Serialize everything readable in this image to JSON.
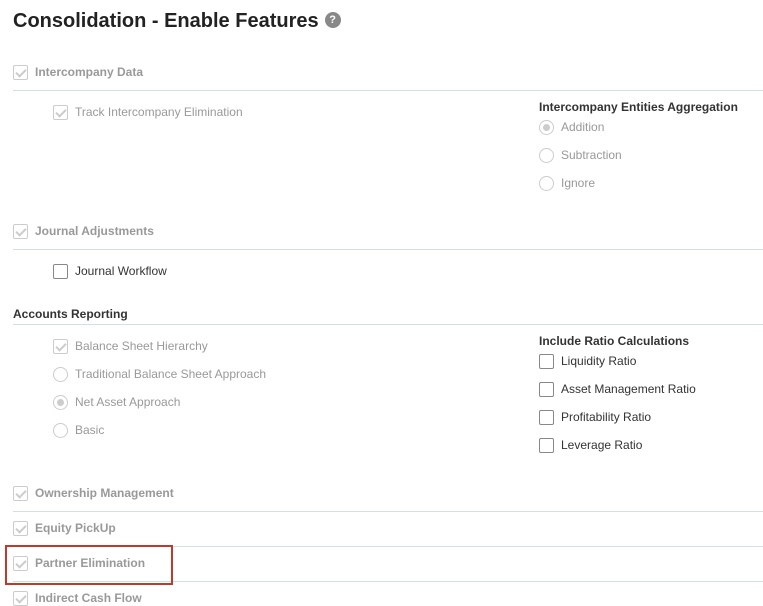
{
  "title": "Consolidation - Enable Features",
  "help_icon": "?",
  "intercompany": {
    "label": "Intercompany Data",
    "checked": true,
    "track": {
      "label": "Track Intercompany Elimination",
      "checked": true
    },
    "aggregation": {
      "heading": "Intercompany Entities Aggregation",
      "options": [
        "Addition",
        "Subtraction",
        "Ignore"
      ],
      "selected": "Addition"
    }
  },
  "journal": {
    "label": "Journal Adjustments",
    "checked": true,
    "workflow": {
      "label": "Journal Workflow",
      "checked": false
    }
  },
  "accounts": {
    "heading": "Accounts Reporting",
    "balance_sheet": {
      "label": "Balance Sheet Hierarchy",
      "checked": true
    },
    "approaches": [
      "Traditional Balance Sheet Approach",
      "Net Asset Approach",
      "Basic"
    ],
    "selected": "Net Asset Approach",
    "ratio": {
      "heading": "Include Ratio Calculations",
      "items": [
        "Liquidity Ratio",
        "Asset Management Ratio",
        "Profitability Ratio",
        "Leverage Ratio"
      ]
    }
  },
  "features": [
    "Ownership Management",
    "Equity PickUp",
    "Partner Elimination",
    "Indirect Cash Flow"
  ],
  "highlight_color": "#c0392b"
}
